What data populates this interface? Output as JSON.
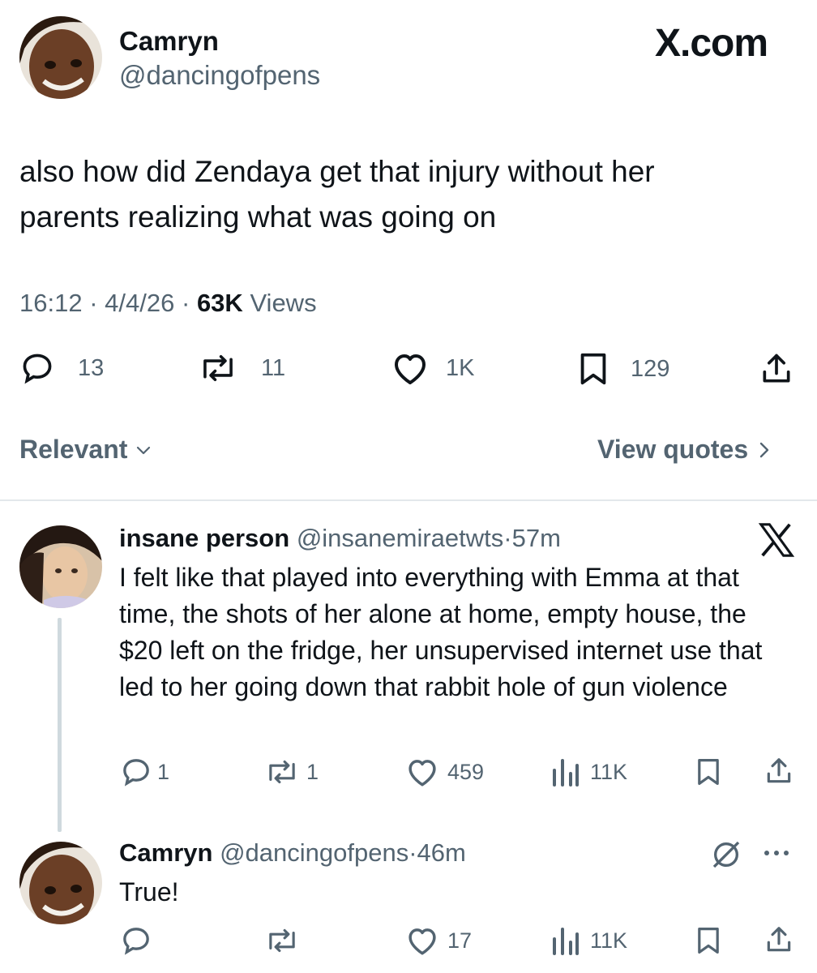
{
  "brand": {
    "logo_text": "X.com"
  },
  "main_tweet": {
    "author_name": "Camryn",
    "author_handle": "@dancingofpens",
    "text": "also how did Zendaya get that injury without her parents realizing what was going on",
    "time": "16:12",
    "date": "4/4/26",
    "views_count": "63K",
    "views_label": "Views",
    "sep": "·",
    "metrics": {
      "replies": "13",
      "reposts": "11",
      "likes": "1K",
      "bookmarks": "129"
    }
  },
  "sort": {
    "label": "Relevant",
    "view_quotes": "View quotes"
  },
  "replies": [
    {
      "author_name": "insane person",
      "author_handle": "@insanemiraetwts",
      "sep": "·",
      "time": "57m",
      "text": "I felt like that played into everything with Emma at that time, the shots of her alone at home, empty house, the $20 left on the fridge, her unsupervised internet use that led to her going down that rabbit hole of gun violence",
      "metrics": {
        "replies": "1",
        "reposts": "1",
        "likes": "459",
        "views": "11K"
      }
    },
    {
      "author_name": "Camryn",
      "author_handle": "@dancingofpens",
      "sep": "·",
      "time": "46m",
      "text": "True!",
      "metrics": {
        "replies": "",
        "reposts": "",
        "likes": "17",
        "views": "11K"
      }
    }
  ],
  "colors": {
    "text": "#0f1419",
    "muted": "#536471",
    "divider": "#cfd9de",
    "thread_line": "#cfd9de"
  }
}
